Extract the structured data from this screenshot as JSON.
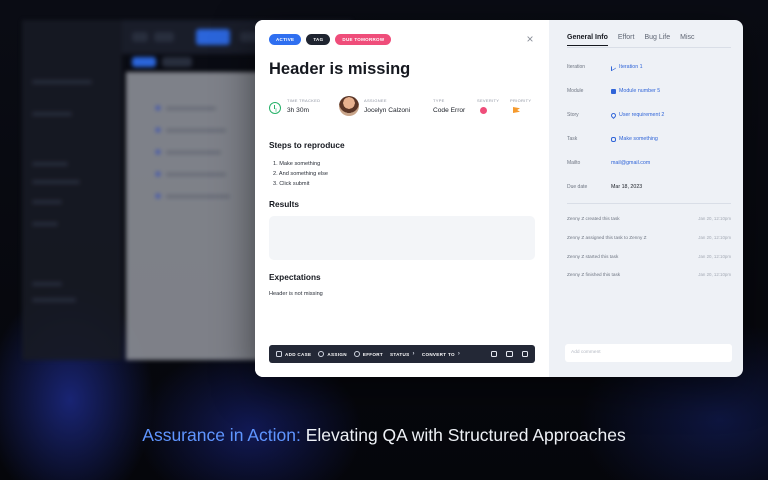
{
  "modal": {
    "tags": [
      "ACTIVE",
      "TAG",
      "DUE TOMORROW"
    ],
    "title": "Header is missing",
    "meta": {
      "time_label": "TIME TRACKED",
      "time_value": "3h 30m",
      "assignee_label": "ASSIGNEE",
      "assignee_value": "Jocelyn Calzoni",
      "type_label": "TYPE",
      "type_value": "Code Error",
      "severity_label": "SEVERITY",
      "priority_label": "PRIORITY"
    },
    "steps_heading": "Steps to reproduce",
    "steps": [
      "1. Make something",
      "2. And something else",
      "3. Click submit"
    ],
    "results_heading": "Results",
    "expectations_heading": "Expectations",
    "expectations_text": "Header is not missing",
    "toolbar": {
      "add_case": "ADD CASE",
      "assign": "ASSIGN",
      "effort": "EFFORT",
      "status": "STATUS",
      "convert_to": "CONVERT TO"
    }
  },
  "panel": {
    "tabs": [
      "General Info",
      "Effort",
      "Bug Life",
      "Misc"
    ],
    "fields": [
      {
        "label": "Iteration",
        "value": "Iteration 1",
        "icon": "trend-icon"
      },
      {
        "label": "Module",
        "value": "Module number 5",
        "icon": "module-icon"
      },
      {
        "label": "Story",
        "value": "User requirement 2",
        "icon": "pin-icon"
      },
      {
        "label": "Task",
        "value": "Make something",
        "icon": "link-icon"
      },
      {
        "label": "Mailto",
        "value": "mail@gmail.com",
        "icon": ""
      },
      {
        "label": "Due date",
        "value": "Mar 18, 2023",
        "icon": ""
      }
    ],
    "activity": [
      {
        "text": "Zenny Z created this task",
        "date": "Jan 20, 12:10pm"
      },
      {
        "text": "Zenny Z assigned this task to Zenny Z",
        "date": "Jan 20, 12:10pm"
      },
      {
        "text": "Zenny Z started this task",
        "date": "Jan 20, 12:10pm"
      },
      {
        "text": "Zenny Z finished this task",
        "date": "Jan 20, 12:10pm"
      }
    ],
    "comment_placeholder": "Add comment"
  },
  "caption": {
    "highlight": "Assurance in Action:",
    "rest": " Elevating QA with Structured Approaches"
  },
  "colors": {
    "accent": "#2f6ff0",
    "tag_pink": "#ef4d7a",
    "caption_highlight": "#5f95ff",
    "timer_green": "#28b26a"
  }
}
